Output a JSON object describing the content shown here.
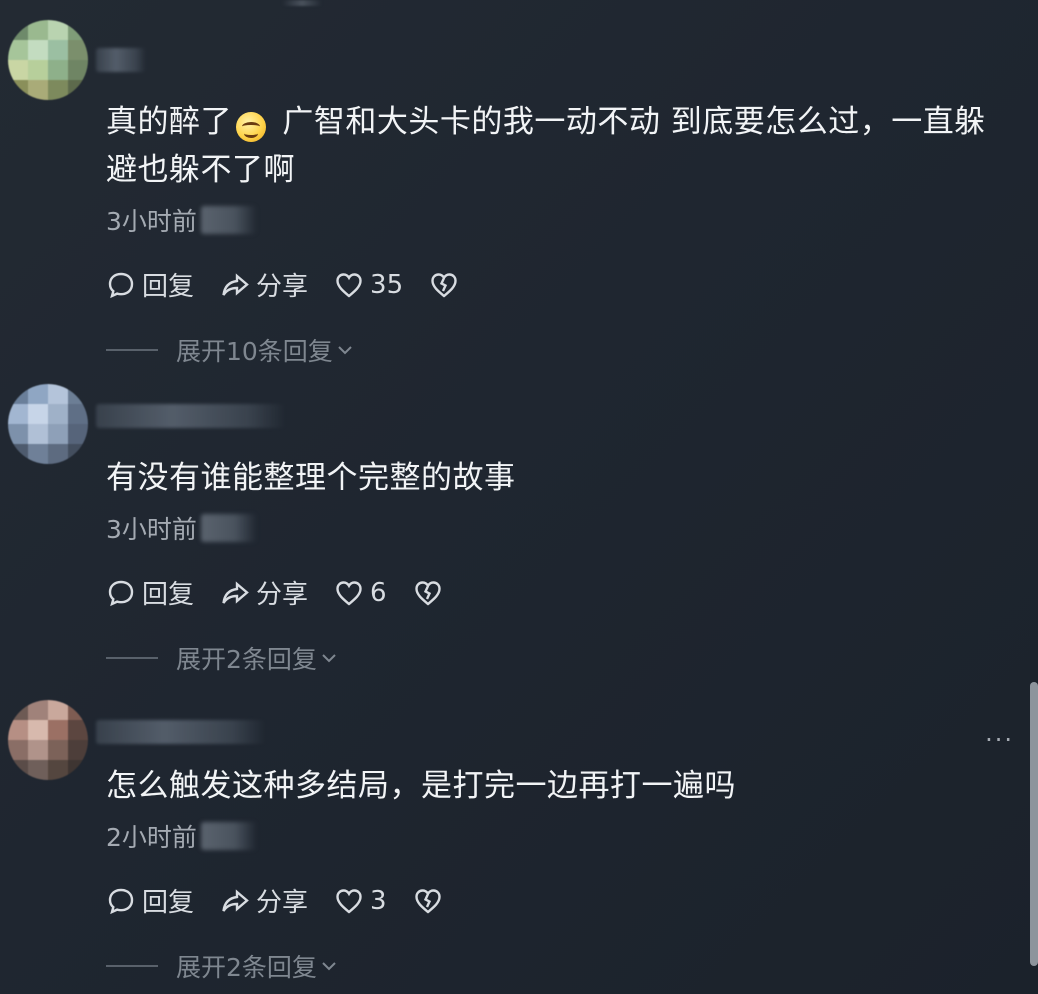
{
  "comments": [
    {
      "text_before_emoji": "真的醉了",
      "emoji": "grinning-face",
      "text_after_emoji": "  广智和大头卡的我一动不动 到底要怎么过，一直躲避也躲不了啊",
      "time": "3小时前",
      "reply_label": "回复",
      "share_label": "分享",
      "likes": "35",
      "expand_label": "展开10条回复"
    },
    {
      "text": "有没有谁能整理个完整的故事",
      "time": "3小时前",
      "reply_label": "回复",
      "share_label": "分享",
      "likes": "6",
      "expand_label": "展开2条回复"
    },
    {
      "text": "怎么触发这种多结局，是打完一边再打一遍吗",
      "time": "2小时前",
      "reply_label": "回复",
      "share_label": "分享",
      "likes": "3",
      "expand_label": "展开2条回复",
      "more_label": "···"
    }
  ],
  "colors": {
    "background": "#1f2630",
    "text": "#f2f4f6",
    "muted": "#a4aab2",
    "expand": "#7f8790"
  },
  "icons": {
    "reply": "comment-bubble-icon",
    "share": "share-arrow-icon",
    "like": "heart-icon",
    "dislike": "broken-heart-icon",
    "expand": "chevron-down-icon",
    "more": "more-dots-icon"
  }
}
